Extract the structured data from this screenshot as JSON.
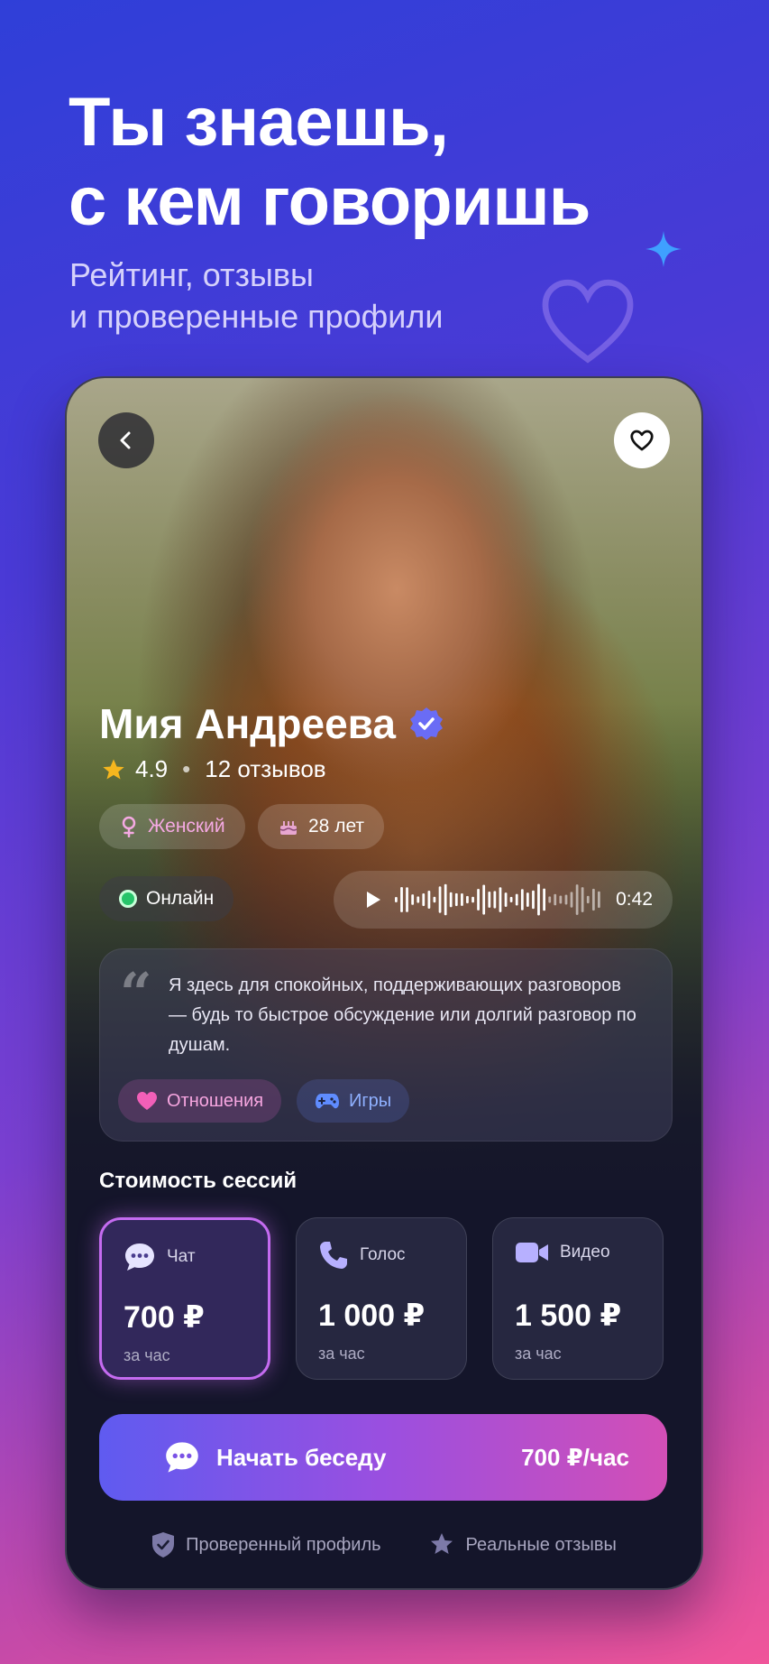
{
  "promo": {
    "headline": "Ты знаешь,\nс кем говоришь",
    "subline": "Рейтинг, отзывы\nи проверенные профили"
  },
  "profile": {
    "name": "Мия Андреева",
    "rating": "4.9",
    "reviews": "12 отзывов",
    "gender": "Женский",
    "age": "28 лет",
    "status": "Онлайн",
    "voice_duration": "0:42",
    "bio": "Я здесь для спокойных, поддерживающих разговоров — будь то быстрое обсуждение или долгий разговор по душам.",
    "tags": [
      "Отношения",
      "Игры"
    ]
  },
  "pricing": {
    "title": "Стоимость сессий",
    "options": [
      {
        "label": "Чат",
        "price": "700 ₽",
        "unit": "за час",
        "selected": true
      },
      {
        "label": "Голос",
        "price": "1 000 ₽",
        "unit": "за час",
        "selected": false
      },
      {
        "label": "Видео",
        "price": "1 500 ₽",
        "unit": "за час",
        "selected": false
      }
    ]
  },
  "cta": {
    "label": "Начать беседу",
    "price": "700 ₽/час"
  },
  "trust": {
    "verified": "Проверенный профиль",
    "real_reviews": "Реальные отзывы"
  },
  "colors": {
    "accent_purple": "#c46bf0",
    "online_green": "#27c46a",
    "star_gold": "#f5b61e",
    "verified_blue": "#6a6cf5"
  },
  "icons": {
    "back": "chevron-left-icon",
    "favorite": "heart-outline-icon",
    "verified": "verified-badge-icon",
    "star": "star-icon",
    "gender": "female-icon",
    "age": "cake-icon",
    "play": "play-icon",
    "quote": "quote-icon",
    "tag_relationships": "heart-icon",
    "tag_games": "gamepad-icon",
    "chat": "chat-bubble-icon",
    "voice": "phone-icon",
    "video": "video-camera-icon",
    "shield": "shield-check-icon",
    "review_star": "review-star-icon"
  }
}
